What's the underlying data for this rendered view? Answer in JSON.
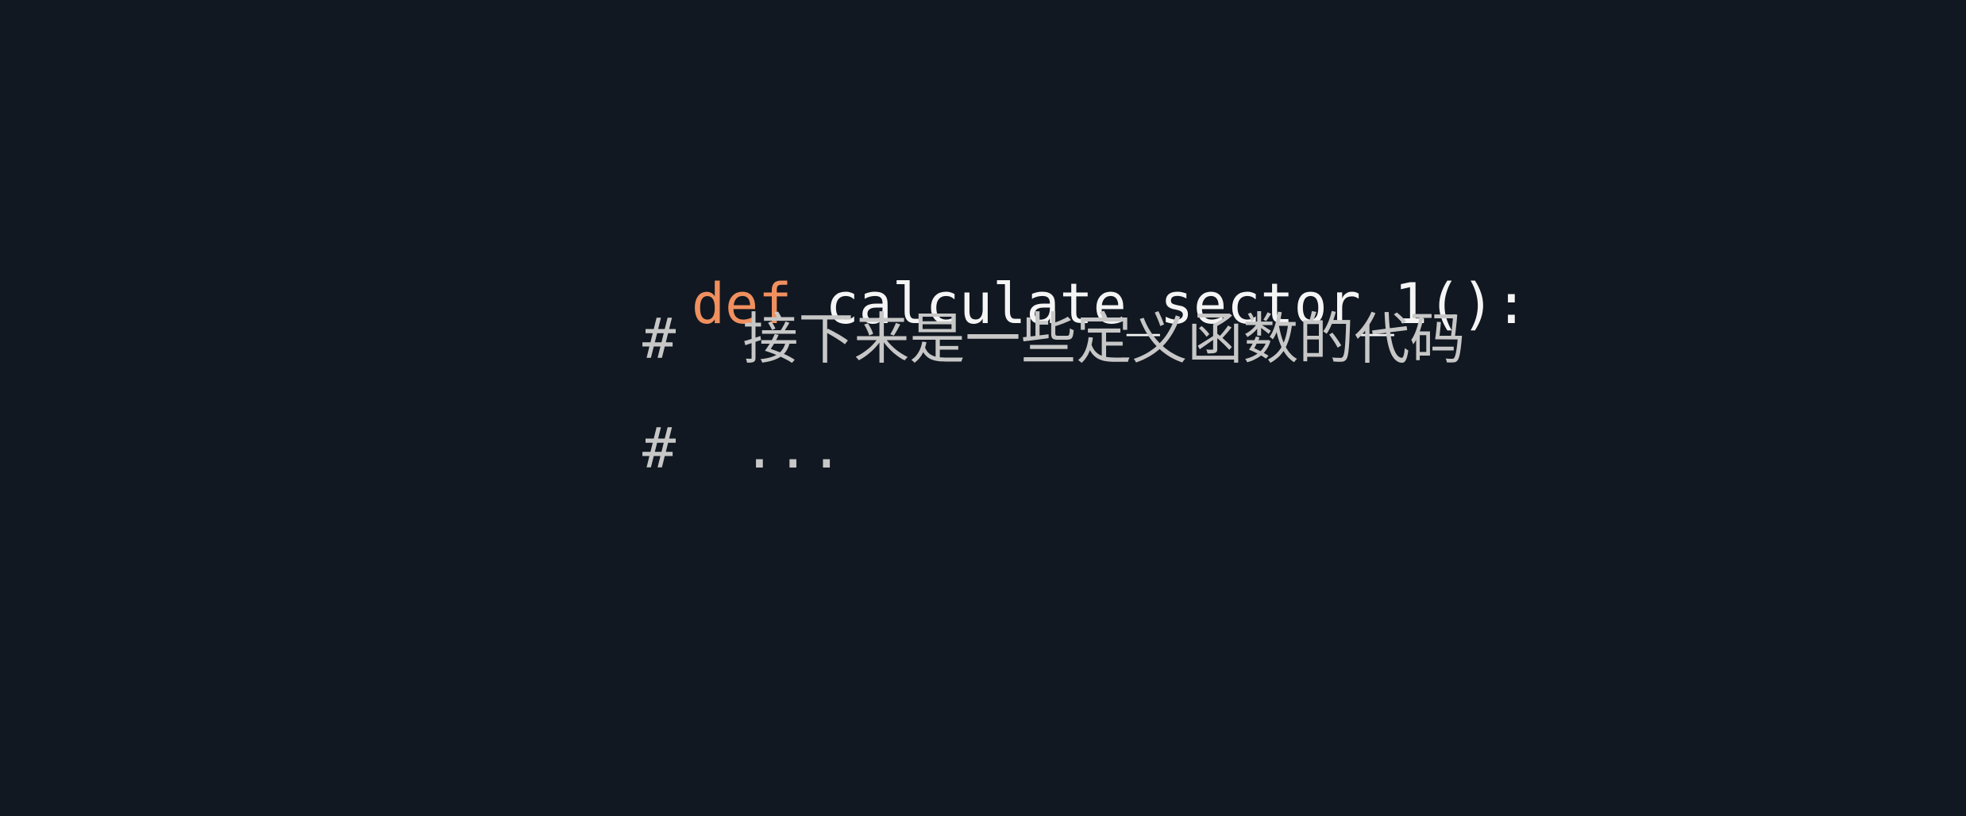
{
  "code": {
    "lines": [
      {
        "keyword": "def",
        "function": "calculate_sector_1():"
      },
      {
        "comment": "#  接下来是一些定义函数的代码"
      },
      {
        "comment": "#  ..."
      }
    ]
  },
  "colors": {
    "background": "#111821",
    "keyword": "#f0905f",
    "function": "#f5f5f5",
    "comment": "#c7c7c7"
  }
}
